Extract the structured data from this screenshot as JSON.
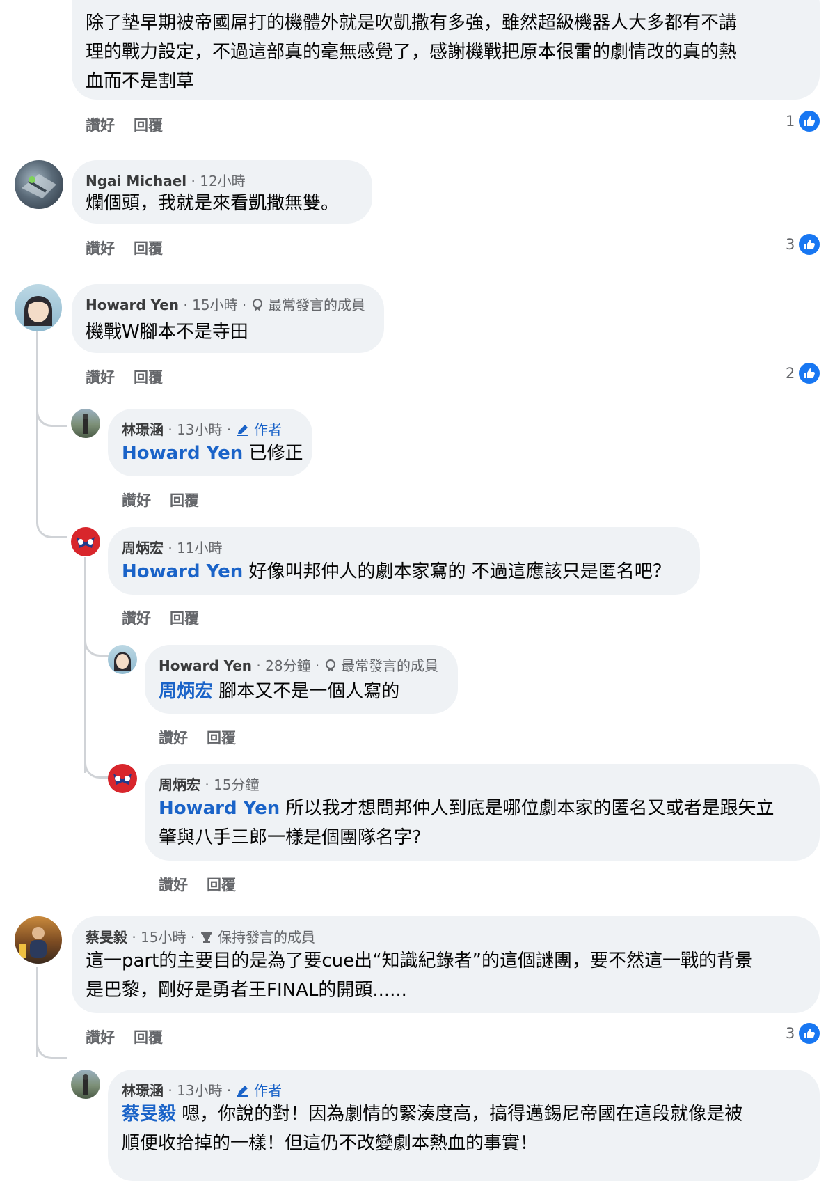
{
  "labels": {
    "like": "讚好",
    "reply": "回覆"
  },
  "comments": [
    {
      "lines": [
        "除了墊早期被帝國屌打的機體外就是吹凱撒有多強，雖然超級機器人大多都有不講",
        "理的戰力設定，不過這部真的毫無感覺了，感謝機戰把原本很雷的劇情改的真的熱",
        "血而不是割草"
      ],
      "likes": "1"
    },
    {
      "author": "Ngai Michael",
      "time": "· 12小時",
      "text": "爛個頭，我就是來看凱撒無雙。",
      "likes": "3"
    },
    {
      "author": "Howard Yen",
      "time": "· 15小時 ·",
      "badge": "最常發言的成員",
      "text": "機戰W腳本不是寺田",
      "likes": "2"
    },
    {
      "author": "林璟涵",
      "time": "· 13小時 ·",
      "badge": "作者",
      "mention": "Howard Yen",
      "text": " 已修正"
    },
    {
      "author": "周炳宏",
      "time": "· 11小時",
      "mention": "Howard Yen",
      "text": " 好像叫邦仲人的劇本家寫的 不過這應該只是匿名吧？"
    },
    {
      "author": "Howard Yen",
      "time": "· 28分鐘 ·",
      "badge": "最常發言的成員",
      "mention": "周炳宏",
      "text": " 腳本又不是一個人寫的"
    },
    {
      "author": "周炳宏",
      "time": "· 15分鐘",
      "mention": "Howard Yen",
      "text": " 所以我才想問邦仲人到底是哪位劇本家的匿名又或者是跟矢立",
      "text2": "肇與八手三郎一樣是個團隊名字?"
    },
    {
      "author": "蔡旻毅",
      "time": "· 15小時 ·",
      "badge": "保持發言的成員",
      "text": "這一part的主要目的是為了要cue出“知識紀錄者”的這個謎團，要不然這一戰的背景",
      "text2": "是巴黎，剛好是勇者王FINAL的開頭......",
      "likes": "3"
    },
    {
      "author": "林璟涵",
      "time": "· 13小時 ·",
      "badge": "作者",
      "mention": "蔡旻毅",
      "text": " 嗯，你說的對！因為劇情的緊湊度高，搞得邁錫尼帝國在這段就像是被",
      "text2": "順便收拾掉的一樣！但這仍不改變劇本熱血的事實！"
    }
  ],
  "colors": {
    "bubble": "#eff2f5",
    "mention": "#1a63c8",
    "like": "#1877f2"
  }
}
